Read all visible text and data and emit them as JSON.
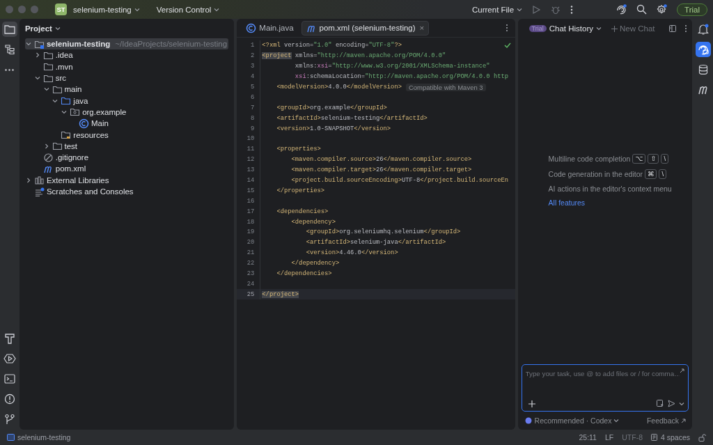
{
  "title_bar": {
    "project_badge": "ST",
    "project": "selenium-testing",
    "vcs": "Version Control",
    "run_config": "Current File",
    "trial": "Trial"
  },
  "left_toolbar": {
    "top": [
      {
        "kind": "project",
        "selected": true
      },
      {
        "kind": "structure",
        "selected": false
      },
      {
        "kind": "more",
        "selected": false
      }
    ],
    "bottom": [
      {
        "kind": "build",
        "selected": false
      },
      {
        "kind": "services",
        "selected": false
      },
      {
        "kind": "terminal",
        "selected": false
      },
      {
        "kind": "problems",
        "selected": false
      },
      {
        "kind": "git",
        "selected": false
      }
    ]
  },
  "project_panel": {
    "title": "Project",
    "tree": [
      {
        "label": "selenium-testing",
        "hint": "~/IdeaProjects/selenium-testing",
        "kind": "module",
        "expanded": true,
        "selected": true,
        "children": [
          {
            "label": ".idea",
            "kind": "folder",
            "expanded": false,
            "selected": false
          },
          {
            "label": ".mvn",
            "kind": "folder",
            "selected": false
          },
          {
            "label": "src",
            "kind": "folder",
            "expanded": true,
            "selected": false,
            "children": [
              {
                "label": "main",
                "kind": "folder",
                "expanded": true,
                "selected": false,
                "children": [
                  {
                    "label": "java",
                    "kind": "source",
                    "expanded": true,
                    "selected": false,
                    "children": [
                      {
                        "label": "org.example",
                        "kind": "package",
                        "expanded": true,
                        "selected": false,
                        "children": [
                          {
                            "label": "Main",
                            "kind": "class",
                            "selected": false
                          }
                        ]
                      }
                    ]
                  },
                  {
                    "label": "resources",
                    "kind": "resources",
                    "selected": false
                  }
                ]
              },
              {
                "label": "test",
                "kind": "folder",
                "expanded": false,
                "selected": false
              }
            ]
          },
          {
            "label": ".gitignore",
            "kind": "ignore",
            "selected": false
          },
          {
            "label": "pom.xml",
            "kind": "maven",
            "selected": false
          }
        ]
      },
      {
        "label": "External Libraries",
        "kind": "libraries",
        "expanded": false,
        "selected": false
      },
      {
        "label": "Scratches and Consoles",
        "kind": "scratches",
        "selected": false
      }
    ]
  },
  "editor": {
    "tabs": [
      {
        "label": "Main.java",
        "kind": "class",
        "selected": false
      },
      {
        "label": "pom.xml (selenium-testing)",
        "kind": "maven",
        "selected": true,
        "close": "×"
      }
    ],
    "lines": [
      {
        "number": "1",
        "current": false,
        "tokens": [
          {
            "kind": "tag",
            "text": "<?xml"
          },
          {
            "kind": "text",
            "text": " version="
          },
          {
            "kind": "str",
            "text": "\"1.0\""
          },
          {
            "kind": "text",
            "text": " encoding="
          },
          {
            "kind": "str",
            "text": "\"UTF-8\""
          },
          {
            "kind": "tag",
            "text": "?>"
          }
        ]
      },
      {
        "number": "2",
        "current": false,
        "tokens": [
          {
            "kind": "match",
            "text": "<project"
          },
          {
            "kind": "text",
            "text": " xmlns="
          },
          {
            "kind": "str",
            "text": "\"http://maven.apache.org/POM/4.0.0\""
          }
        ]
      },
      {
        "number": "3",
        "current": false,
        "tokens": [
          {
            "kind": "text",
            "text": "         xmlns:"
          },
          {
            "kind": "ns",
            "text": "xsi"
          },
          {
            "kind": "text",
            "text": "="
          },
          {
            "kind": "str",
            "text": "\"http://www.w3.org/2001/XMLSchema-instance\""
          }
        ]
      },
      {
        "number": "4",
        "current": false,
        "tokens": [
          {
            "kind": "ns",
            "text": "         xsi"
          },
          {
            "kind": "text",
            "text": ":schemaLocation="
          },
          {
            "kind": "str",
            "text": "\"http://maven.apache.org/POM/4.0.0 http"
          }
        ]
      },
      {
        "number": "5",
        "current": false,
        "tokens": [
          {
            "kind": "tag",
            "text": "    <modelVersion>"
          },
          {
            "kind": "text",
            "text": "4.0.0"
          },
          {
            "kind": "tag",
            "text": "</modelVersion>"
          }
        ],
        "hint": "Compatible with Maven 3"
      },
      {
        "number": "6",
        "current": false
      },
      {
        "number": "7",
        "current": false,
        "tokens": [
          {
            "kind": "tag",
            "text": "    <groupId>"
          },
          {
            "kind": "text",
            "text": "org.example"
          },
          {
            "kind": "tag",
            "text": "</groupId>"
          }
        ]
      },
      {
        "number": "8",
        "current": false,
        "tokens": [
          {
            "kind": "tag",
            "text": "    <artifactId>"
          },
          {
            "kind": "text",
            "text": "selenium-testing"
          },
          {
            "kind": "tag",
            "text": "</artifactId>"
          }
        ]
      },
      {
        "number": "9",
        "current": false,
        "tokens": [
          {
            "kind": "tag",
            "text": "    <version>"
          },
          {
            "kind": "text",
            "text": "1.0-SNAPSHOT"
          },
          {
            "kind": "tag",
            "text": "</version>"
          }
        ]
      },
      {
        "number": "10",
        "current": false
      },
      {
        "number": "11",
        "current": false,
        "tokens": [
          {
            "kind": "tag",
            "text": "    <properties>"
          }
        ]
      },
      {
        "number": "12",
        "current": false,
        "tokens": [
          {
            "kind": "tag",
            "text": "        <maven.compiler.source>"
          },
          {
            "kind": "text",
            "text": "26"
          },
          {
            "kind": "tag",
            "text": "</maven.compiler.source>"
          }
        ]
      },
      {
        "number": "13",
        "current": false,
        "tokens": [
          {
            "kind": "tag",
            "text": "        <maven.compiler.target>"
          },
          {
            "kind": "text",
            "text": "26"
          },
          {
            "kind": "tag",
            "text": "</maven.compiler.target>"
          }
        ]
      },
      {
        "number": "14",
        "current": false,
        "tokens": [
          {
            "kind": "tag",
            "text": "        <project.build.sourceEncoding>"
          },
          {
            "kind": "text",
            "text": "UTF-8"
          },
          {
            "kind": "tag",
            "text": "</project.build.sourceEn"
          }
        ]
      },
      {
        "number": "15",
        "current": false,
        "tokens": [
          {
            "kind": "tag",
            "text": "    </properties>"
          }
        ]
      },
      {
        "number": "16",
        "current": false
      },
      {
        "number": "17",
        "current": false,
        "tokens": [
          {
            "kind": "tag",
            "text": "    <dependencies>"
          }
        ]
      },
      {
        "number": "18",
        "current": false,
        "tokens": [
          {
            "kind": "tag",
            "text": "        <dependency>"
          }
        ]
      },
      {
        "number": "19",
        "current": false,
        "tokens": [
          {
            "kind": "tag",
            "text": "            <groupId>"
          },
          {
            "kind": "text",
            "text": "org.seleniumhq.selenium"
          },
          {
            "kind": "tag",
            "text": "</groupId>"
          }
        ]
      },
      {
        "number": "20",
        "current": false,
        "tokens": [
          {
            "kind": "tag",
            "text": "            <artifactId>"
          },
          {
            "kind": "text",
            "text": "selenium-java"
          },
          {
            "kind": "tag",
            "text": "</artifactId>"
          }
        ]
      },
      {
        "number": "21",
        "current": false,
        "tokens": [
          {
            "kind": "tag",
            "text": "            <version>"
          },
          {
            "kind": "text",
            "text": "4.46.0"
          },
          {
            "kind": "tag",
            "text": "</version>"
          }
        ]
      },
      {
        "number": "22",
        "current": false,
        "tokens": [
          {
            "kind": "tag",
            "text": "        </dependency>"
          }
        ]
      },
      {
        "number": "23",
        "current": false,
        "tokens": [
          {
            "kind": "tag",
            "text": "    </dependencies>"
          }
        ]
      },
      {
        "number": "24",
        "current": false
      },
      {
        "number": "25",
        "current": true,
        "tokens": [
          {
            "kind": "match",
            "text": "</project>"
          }
        ]
      }
    ]
  },
  "chat": {
    "badge": "Trial",
    "title": "Chat History",
    "new_chat": "New Chat",
    "tips": [
      {
        "text": "Multiline code completion",
        "keys": [
          "⌥",
          "⇧",
          "\\"
        ]
      },
      {
        "text": "Code generation in the editor",
        "keys": [
          "⌘",
          "\\"
        ]
      },
      {
        "text": "AI actions in the editor's context menu"
      }
    ],
    "link": "All features",
    "input": {
      "placeholder": "Type your task, use @ to add files or / for comma…"
    },
    "model": "Recommended · Codex",
    "feedback": "Feedback"
  },
  "right_toolbar": [
    {
      "kind": "notifications",
      "selected": false
    },
    {
      "kind": "ai-chat",
      "selected": true
    },
    {
      "kind": "database",
      "selected": false
    },
    {
      "kind": "maven",
      "selected": false
    }
  ],
  "status_bar": {
    "project": "selenium-testing",
    "position": "25:11",
    "line_sep": "LF",
    "encoding": "UTF-8",
    "indent": "4 spaces"
  }
}
